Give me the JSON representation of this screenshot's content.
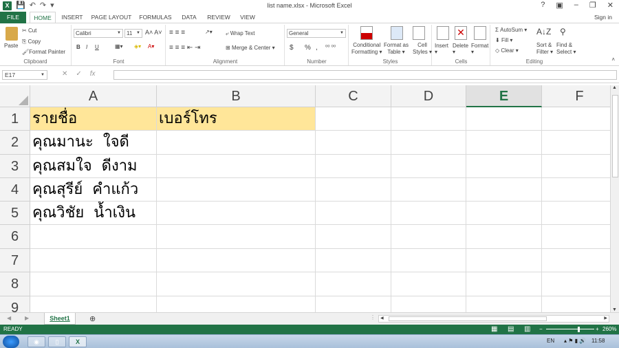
{
  "window": {
    "title": "list name.xlsx - Microsoft Excel",
    "help": "?",
    "min": "–",
    "restore": "❐",
    "close": "✕"
  },
  "tabs": [
    "FILE",
    "HOME",
    "INSERT",
    "PAGE LAYOUT",
    "FORMULAS",
    "DATA",
    "REVIEW",
    "VIEW"
  ],
  "sign_in": "Sign in",
  "ribbon": {
    "clipboard": {
      "paste": "Paste",
      "cut": "Cut",
      "copy": "Copy",
      "format_painter": "Format Painter",
      "label": "Clipboard"
    },
    "font": {
      "name": "Calibri",
      "size": "11",
      "bold": "B",
      "italic": "I",
      "underline": "U",
      "label": "Font"
    },
    "alignment": {
      "wrap": "Wrap Text",
      "merge": "Merge & Center",
      "label": "Alignment"
    },
    "number": {
      "format": "General",
      "currency": "$",
      "percent": "%",
      "comma": ",",
      "label": "Number"
    },
    "styles": {
      "conditional": "Conditional",
      "conditional2": "Formatting",
      "format_as": "Format as",
      "format_as2": "Table",
      "cell": "Cell",
      "cell2": "Styles",
      "label": "Styles"
    },
    "cells": {
      "insert": "Insert",
      "delete": "Delete",
      "format": "Format",
      "label": "Cells"
    },
    "editing": {
      "autosum": "AutoSum",
      "fill": "Fill",
      "clear": "Clear",
      "sort": "Sort &",
      "sort2": "Filter",
      "find": "Find &",
      "find2": "Select",
      "label": "Editing"
    }
  },
  "formula_bar": {
    "name_box": "E17",
    "fx": "fx",
    "value": ""
  },
  "columns": [
    "A",
    "B",
    "C",
    "D",
    "E",
    "F"
  ],
  "rows": [
    "1",
    "2",
    "3",
    "4",
    "5",
    "6",
    "7",
    "8",
    "9"
  ],
  "cells": {
    "A1": "รายชื่อ",
    "B1": "เบอร์โทร",
    "A2": "คุณมานะ  ใจดี",
    "A3": "คุณสมใจ  ดีงาม",
    "A4": "คุณสุรีย์  คำแก้ว",
    "A5": "คุณวิชัย  น้ำเงิน"
  },
  "sheet_tab": "Sheet1",
  "status": {
    "ready": "READY",
    "zoom": "260%"
  },
  "taskbar": {
    "lang": "EN",
    "time": "11:58"
  },
  "colors": {
    "excel_green": "#217346",
    "header_fill": "#ffe699"
  }
}
